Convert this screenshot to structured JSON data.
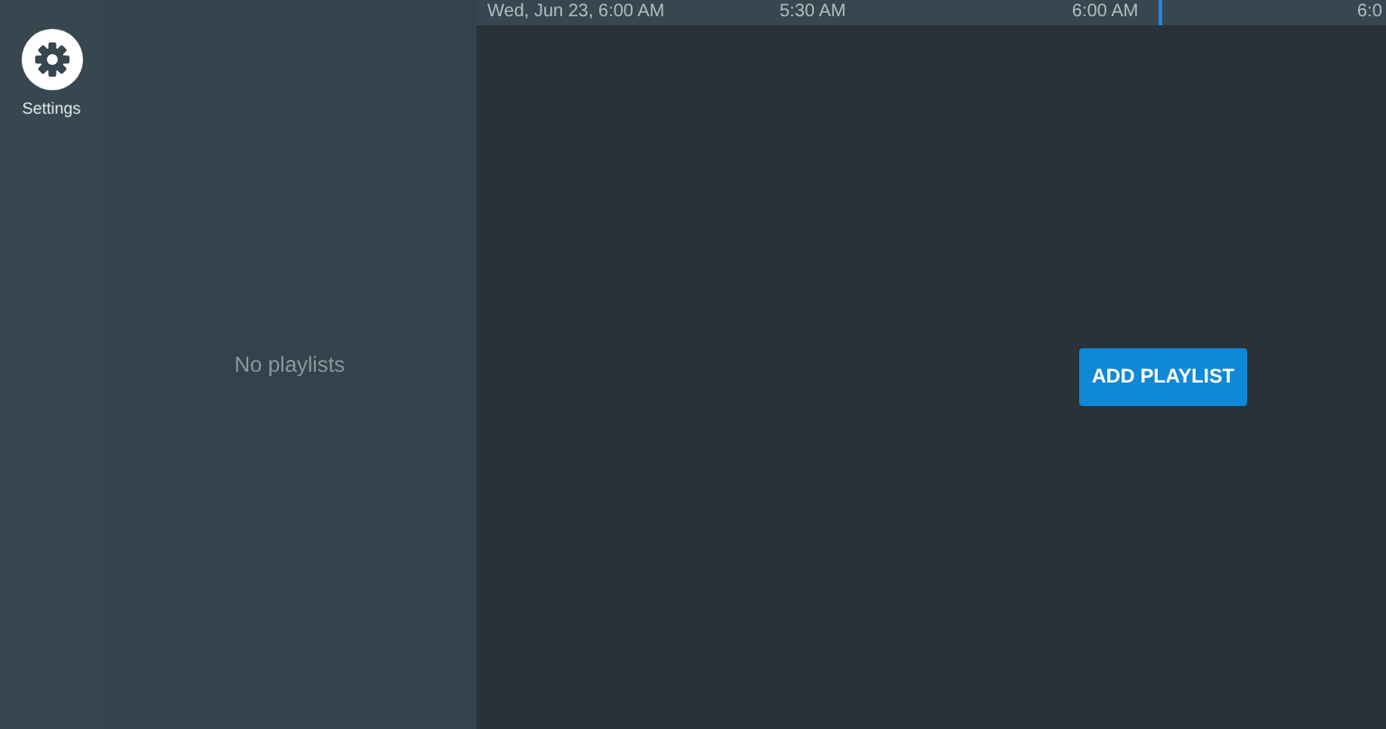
{
  "sidebar": {
    "items": [
      {
        "label": "Settings"
      }
    ]
  },
  "playlists": {
    "empty_text": "No playlists"
  },
  "timeline": {
    "date": "Wed, Jun 23, 6:00 AM",
    "ticks": [
      "5:30 AM",
      "6:00 AM",
      "6:0"
    ],
    "now_marker": {
      "level": 0.75
    }
  },
  "main": {
    "button": "ADD PLAYLIST"
  }
}
